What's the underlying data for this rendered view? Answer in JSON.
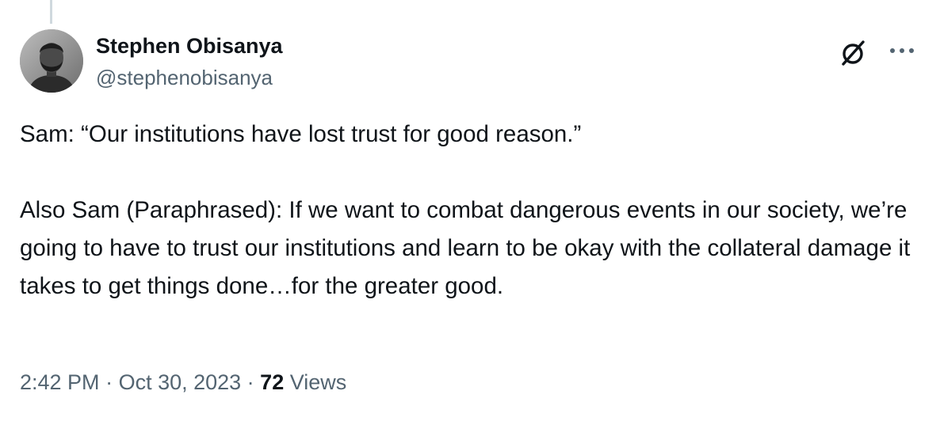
{
  "author": {
    "name": "Stephen Obisanya",
    "handle": "@stephenobisanya"
  },
  "tweet": {
    "text": "Sam: “Our institutions have lost trust for good reason.”\n\nAlso Sam (Paraphrased): If we want to combat dangerous events in our society, we’re going to have to trust our institutions and learn to be okay with the collateral damage it takes to get things done…for the greater good."
  },
  "meta": {
    "time": "2:42 PM",
    "separator": " · ",
    "date": "Oct 30, 2023",
    "views_count": "72",
    "views_label": " Views"
  },
  "icons": {
    "grok": "grok-icon",
    "more": "more-icon",
    "avatar": "avatar"
  },
  "colors": {
    "text": "#0f1419",
    "secondary": "#536471",
    "thread_line": "#cfd9de"
  }
}
